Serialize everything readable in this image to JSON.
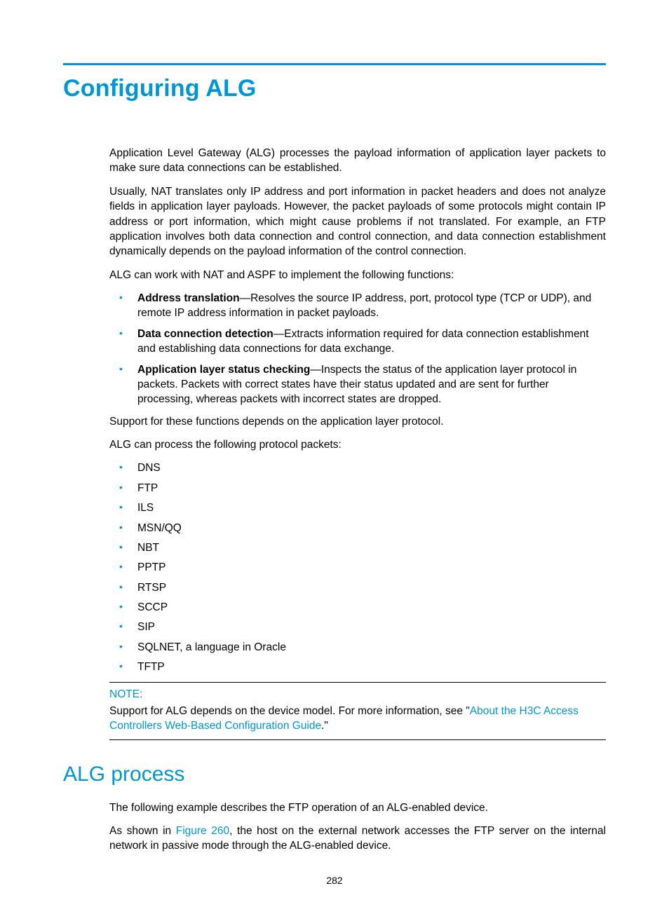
{
  "title": "Configuring ALG",
  "intro_p1": "Application Level Gateway (ALG) processes the payload information of application layer packets to make sure data connections can be established.",
  "intro_p2": "Usually, NAT translates only IP address and port information in packet headers and does not analyze fields in application layer payloads. However, the packet payloads of some protocols might contain IP address or port information, which might cause problems if not translated. For example, an FTP application involves both data connection and control connection, and data connection establishment dynamically depends on the payload information of the control connection.",
  "intro_p3": "ALG can work with NAT and ASPF to implement the following functions:",
  "functions": [
    {
      "term": "Address translation",
      "desc": "—Resolves the source IP address, port, protocol type (TCP or UDP), and remote IP address information in packet payloads."
    },
    {
      "term": "Data connection detection",
      "desc": "—Extracts information required for data connection establishment and establishing data connections for data exchange."
    },
    {
      "term": "Application layer status checking",
      "desc": "—Inspects the status of the application layer protocol in packets. Packets with correct states have their status updated and are sent for further processing, whereas packets with incorrect states are dropped."
    }
  ],
  "support_p": "Support for these functions depends on the application layer protocol.",
  "protocols_intro": "ALG can process the following protocol packets:",
  "protocols": [
    "DNS",
    "FTP",
    "ILS",
    "MSN/QQ",
    "NBT",
    "PPTP",
    "RTSP",
    "SCCP",
    "SIP",
    "SQLNET, a language in Oracle",
    "TFTP"
  ],
  "note_label": "NOTE:",
  "note_text_pre": "Support for ALG depends on the device model. For more information, see \"",
  "note_link": "About the H3C Access Controllers Web-Based Configuration Guide",
  "note_text_post": ".\"",
  "h2": "ALG process",
  "process_p1": "The following example describes the FTP operation of an ALG-enabled device.",
  "process_p2_pre": "As shown in ",
  "process_p2_link": "Figure 260",
  "process_p2_post": ", the host on the external network accesses the FTP server on the internal network in passive mode through the ALG-enabled device.",
  "page_number": "282"
}
